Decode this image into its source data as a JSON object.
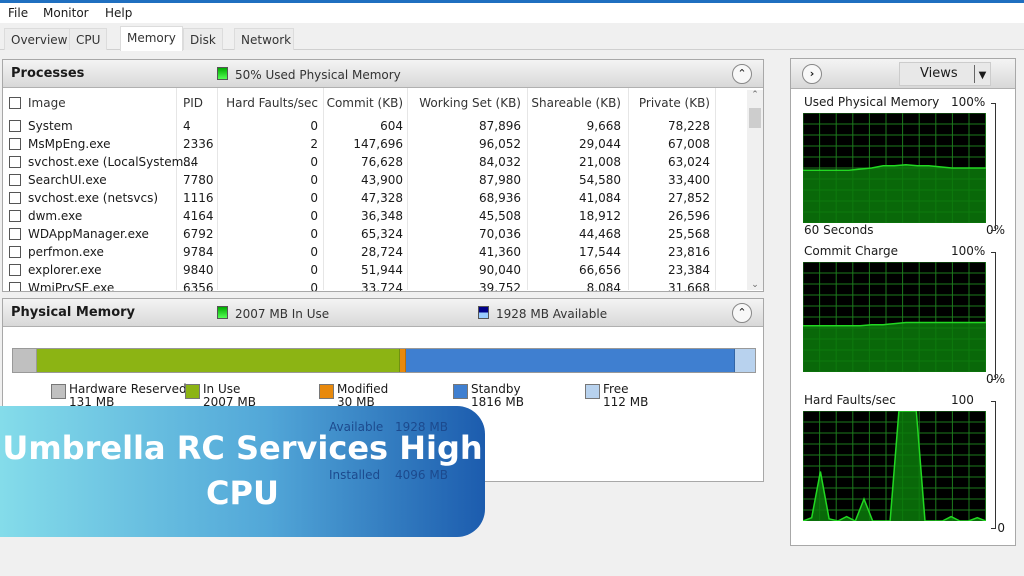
{
  "menu": [
    "File",
    "Monitor",
    "Help"
  ],
  "tabs": [
    "Overview",
    "CPU",
    "Memory",
    "Disk",
    "Network"
  ],
  "active_tab": "Memory",
  "processes": {
    "title": "Processes",
    "status": "50% Used Physical Memory",
    "columns": [
      "Image",
      "PID",
      "Hard Faults/sec",
      "Commit (KB)",
      "Working Set (KB)",
      "Shareable (KB)",
      "Private (KB)"
    ],
    "rows": [
      [
        "System",
        "4",
        "0",
        "604",
        "87,896",
        "9,668",
        "78,228"
      ],
      [
        "MsMpEng.exe",
        "2336",
        "2",
        "147,696",
        "96,052",
        "29,044",
        "67,008"
      ],
      [
        "svchost.exe (LocalSystem...",
        "84",
        "0",
        "76,628",
        "84,032",
        "21,008",
        "63,024"
      ],
      [
        "SearchUI.exe",
        "7780",
        "0",
        "43,900",
        "87,980",
        "54,580",
        "33,400"
      ],
      [
        "svchost.exe (netsvcs)",
        "1116",
        "0",
        "47,328",
        "68,936",
        "41,084",
        "27,852"
      ],
      [
        "dwm.exe",
        "4164",
        "0",
        "36,348",
        "45,508",
        "18,912",
        "26,596"
      ],
      [
        "WDAppManager.exe",
        "6792",
        "0",
        "65,324",
        "70,036",
        "44,468",
        "25,568"
      ],
      [
        "perfmon.exe",
        "9784",
        "0",
        "28,724",
        "41,360",
        "17,544",
        "23,816"
      ],
      [
        "explorer.exe",
        "9840",
        "0",
        "51,944",
        "90,040",
        "66,656",
        "23,384"
      ],
      [
        "WmiPrvSE.exe",
        "6356",
        "0",
        "33,724",
        "39,752",
        "8,084",
        "31,668"
      ]
    ]
  },
  "physical": {
    "title": "Physical Memory",
    "in_use_status": "2007 MB In Use",
    "available_status": "1928 MB Available",
    "segments": [
      {
        "label": "Hardware Reserved",
        "value": "131 MB",
        "mb": 131,
        "color": "#c0c0c0"
      },
      {
        "label": "In Use",
        "value": "2007 MB",
        "mb": 2007,
        "color": "#8cb414"
      },
      {
        "label": "Modified",
        "value": "30 MB",
        "mb": 30,
        "color": "#e8890c"
      },
      {
        "label": "Standby",
        "value": "1816 MB",
        "mb": 1816,
        "color": "#3f7fd0"
      },
      {
        "label": "Free",
        "value": "112 MB",
        "mb": 112,
        "color": "#b8d2ee"
      }
    ],
    "summary": [
      {
        "label": "Available",
        "value": "1928 MB"
      },
      {
        "label": "Installed",
        "value": "4096 MB"
      }
    ]
  },
  "banner": {
    "line1": "Umbrella RC Services High",
    "line2": "CPU"
  },
  "side": {
    "views_label": "Views",
    "graphs": [
      {
        "title": "Used Physical Memory",
        "max": "100%",
        "min": "0%",
        "footer": "60 Seconds",
        "levels": [
          48,
          48,
          48,
          48,
          48,
          49,
          50,
          52,
          52,
          53,
          52,
          52,
          51,
          50,
          50,
          50,
          50
        ]
      },
      {
        "title": "Commit Charge",
        "max": "100%",
        "min": "0%",
        "levels": [
          42,
          42,
          42,
          42,
          42,
          42,
          43,
          43,
          44,
          45,
          45,
          45,
          45,
          45,
          45,
          45,
          45
        ]
      },
      {
        "title": "Hard Faults/sec",
        "max": "100",
        "min": "0",
        "levels": [
          0,
          3,
          45,
          2,
          0,
          4,
          0,
          20,
          0,
          0,
          0,
          100,
          100,
          100,
          0,
          0,
          0,
          4,
          0,
          0,
          3,
          0
        ]
      }
    ]
  },
  "colors": {
    "graph_line": "#22d822",
    "graph_fill": "#0a7a0a",
    "grid": "#1d7a1d"
  }
}
